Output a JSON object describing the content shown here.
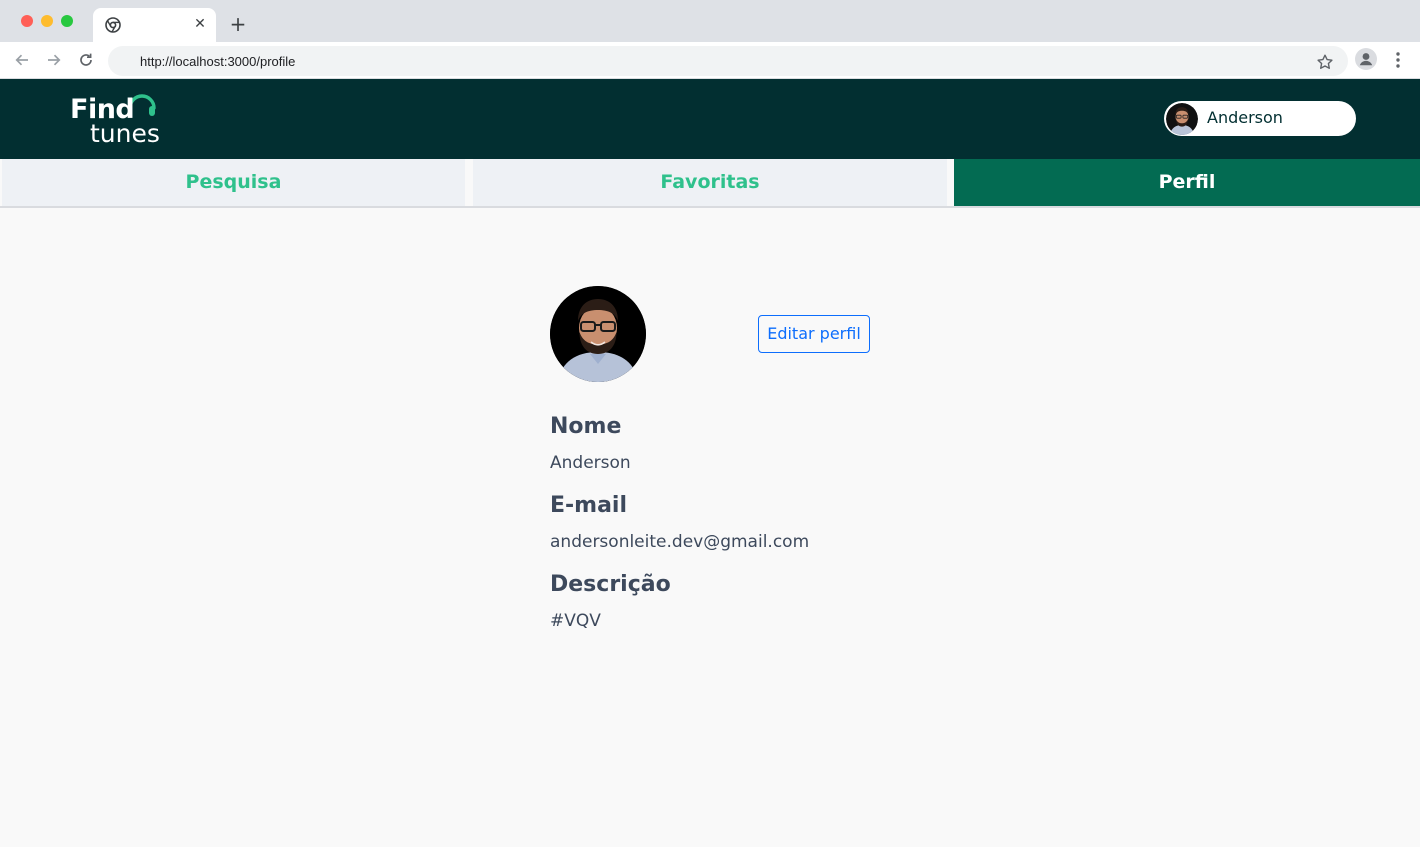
{
  "browser": {
    "url": "http://localhost:3000/profile",
    "icons": {
      "back": "arrow-left-icon",
      "forward": "arrow-right-icon",
      "reload": "reload-icon",
      "bookmark": "star-icon",
      "profile": "account-icon",
      "menu": "kebab-menu-icon",
      "tab_close": "close-icon",
      "new_tab": "plus-icon"
    },
    "tab_close_glyph": "✕",
    "new_tab_glyph": "+"
  },
  "header": {
    "logo": {
      "line1": "Find",
      "line2": "tunes"
    },
    "user": {
      "name": "Anderson"
    }
  },
  "nav": {
    "tabs": [
      {
        "label": "Pesquisa",
        "active": false
      },
      {
        "label": "Favoritas",
        "active": false
      },
      {
        "label": "Perfil",
        "active": true
      }
    ]
  },
  "profile": {
    "edit_button": "Editar perfil",
    "fields": [
      {
        "label": "Nome",
        "value": "Anderson"
      },
      {
        "label": "E-mail",
        "value": "andersonleite.dev@gmail.com"
      },
      {
        "label": "Descrição",
        "value": "#VQV"
      }
    ]
  },
  "colors": {
    "header_bg": "#022f31",
    "accent_green": "#2fc18c",
    "active_tab_bg": "#036b52",
    "button_blue": "#0d6efd",
    "text_dark": "#3d495c"
  }
}
